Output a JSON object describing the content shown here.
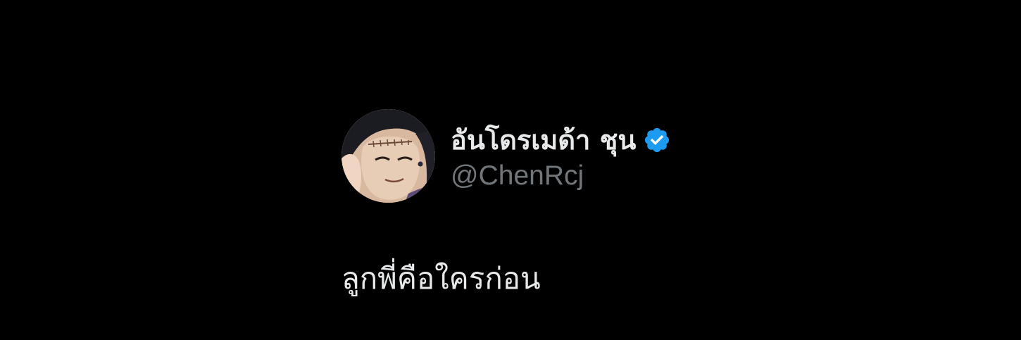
{
  "author": {
    "display_name": "อันโดรเมด้า ชุน",
    "handle": "@ChenRcj",
    "verified": true,
    "avatar": "anime-character-avatar"
  },
  "tweet": {
    "text": "ลูกพี่คือใครก่อน"
  },
  "colors": {
    "background": "#000000",
    "primary_text": "#e7e9ea",
    "secondary_text": "#71767b",
    "verified_badge": "#1d9bf0"
  }
}
